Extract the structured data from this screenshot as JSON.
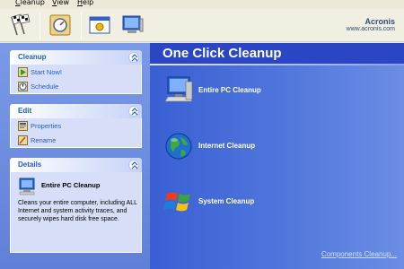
{
  "menu": [
    {
      "first": "C",
      "rest": "leanup"
    },
    {
      "first": "V",
      "rest": "iew"
    },
    {
      "first": "H",
      "rest": "elp"
    }
  ],
  "logo": {
    "brand": "Acronis",
    "url": "www.acronis.com"
  },
  "toolbar_icons": [
    "checkered-flag-icon",
    "wizard-dial-icon",
    "options-icon",
    "computer-window-icon"
  ],
  "sidebar": {
    "cleanup": {
      "title": "Cleanup",
      "tasks": [
        {
          "label": "Start Now!",
          "icon": "start-icon"
        },
        {
          "label": "Schedule",
          "icon": "schedule-icon"
        }
      ]
    },
    "edit": {
      "title": "Edit",
      "tasks": [
        {
          "label": "Properties",
          "icon": "properties-icon"
        },
        {
          "label": "Rename",
          "icon": "rename-icon"
        }
      ]
    },
    "details": {
      "title": "Details",
      "item_title": "Entire PC Cleanup",
      "description": "Cleans your entire computer, including ALL Internet and system activity traces, and securely wipes hard disk free space."
    }
  },
  "main": {
    "title": "One Click Cleanup",
    "actions": [
      {
        "label": "Entire PC Cleanup",
        "icon": "computer-icon"
      },
      {
        "label": "Internet Cleanup",
        "icon": "globe-icon"
      },
      {
        "label": "System Cleanup",
        "icon": "windows-logo-icon"
      }
    ],
    "components_link": "Components Cleanup..."
  }
}
